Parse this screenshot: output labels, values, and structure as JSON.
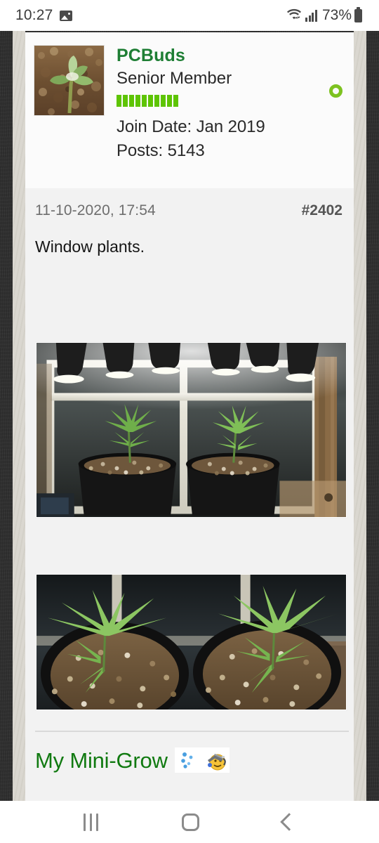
{
  "status_bar": {
    "time": "10:27",
    "photo_icon": "photo-notification-icon",
    "wifi_icon": "wifi-icon",
    "signal_icon": "cellular-signal-icon",
    "battery_percent": "73%",
    "battery_icon": "battery-icon"
  },
  "post": {
    "user": {
      "avatar_alt": "seedling-avatar",
      "username": "PCBuds",
      "title": "Senior Member",
      "reputation_pips": 10,
      "reputation_color": "#5ec404",
      "online_status": "online",
      "online_color": "#7dc220",
      "join_date": "Join Date: Jan 2019",
      "posts": "Posts: 5143"
    },
    "date": "11-10-2020, 17:54",
    "number": "#2402",
    "text": "Window plants.",
    "attachments": [
      {
        "name": "attachment-photo-1",
        "alt": "Two seedlings in black pots on a windowsill under grow lights"
      },
      {
        "name": "attachment-photo-2",
        "alt": "Close top-down view of two young plants in pots of soil"
      }
    ],
    "signature": {
      "text": "My Mini-Grow",
      "link_color": "#117a11",
      "emotes": [
        "water-drops-emote",
        "watering-can-smiley-emote"
      ]
    }
  },
  "nav_bar": {
    "recents_label": "recents-icon",
    "home_label": "home-icon",
    "back_label": "back-icon"
  },
  "theme": {
    "page_background": "#2e2e2e",
    "gutter": "#d8d5cd",
    "card_background": "#f2f2f2",
    "header_background": "#fbfbfb",
    "username_color": "#1e7e34"
  }
}
